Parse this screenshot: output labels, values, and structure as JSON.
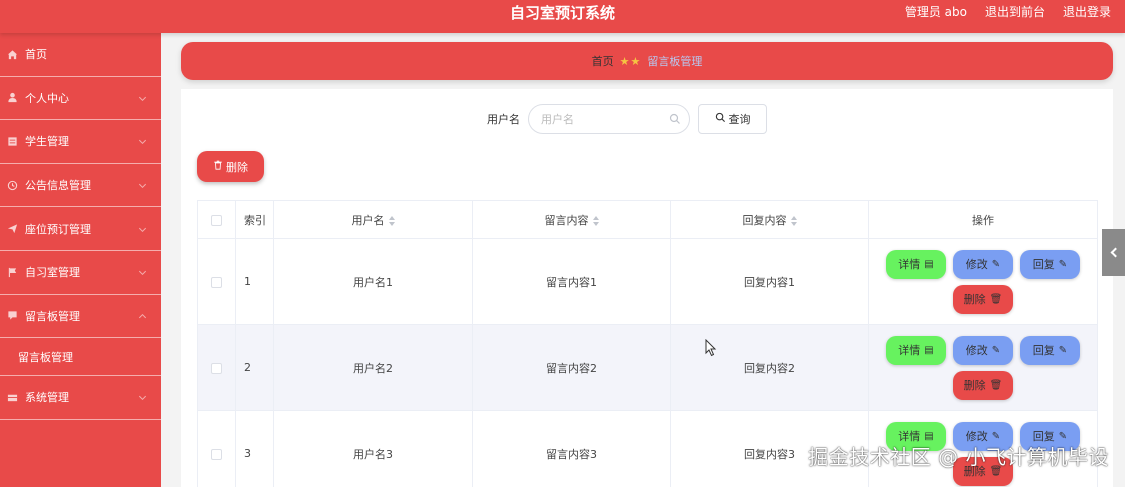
{
  "header": {
    "title": "自习室预订系统",
    "admin_label": "管理员 abo",
    "back_label": "退出到前台",
    "logout_label": "退出登录"
  },
  "sidebar": {
    "items": [
      {
        "label": "首页",
        "icon": "home-icon"
      },
      {
        "label": "个人中心",
        "icon": "user-icon"
      },
      {
        "label": "学生管理",
        "icon": "list-icon"
      },
      {
        "label": "公告信息管理",
        "icon": "clock-icon"
      },
      {
        "label": "座位预订管理",
        "icon": "send-icon"
      },
      {
        "label": "自习室管理",
        "icon": "flag-icon"
      },
      {
        "label": "留言板管理",
        "icon": "comment-icon"
      },
      {
        "label": "系统管理",
        "icon": "box-icon"
      }
    ],
    "submenu": {
      "label": "留言板管理"
    }
  },
  "breadcrumb": {
    "home": "首页",
    "current": "留言板管理"
  },
  "search": {
    "label": "用户名",
    "placeholder": "用户名",
    "query_label": "查询"
  },
  "toolbar": {
    "delete_label": "删除"
  },
  "table": {
    "columns": [
      "索引",
      "用户名",
      "留言内容",
      "回复内容",
      "操作"
    ],
    "rows": [
      {
        "index": "1",
        "username": "用户名1",
        "message": "留言内容1",
        "reply": "回复内容1"
      },
      {
        "index": "2",
        "username": "用户名2",
        "message": "留言内容2",
        "reply": "回复内容2"
      },
      {
        "index": "3",
        "username": "用户名3",
        "message": "留言内容3",
        "reply": "回复内容3"
      }
    ],
    "actions": {
      "detail": "详情",
      "edit": "修改",
      "reply": "回复",
      "remove": "删除"
    }
  },
  "watermark": "掘金技术社区 @ 小飞计算机毕设",
  "colors": {
    "primary": "#e84a49",
    "detail": "#67f25f",
    "edit": "#7a9ef2"
  }
}
